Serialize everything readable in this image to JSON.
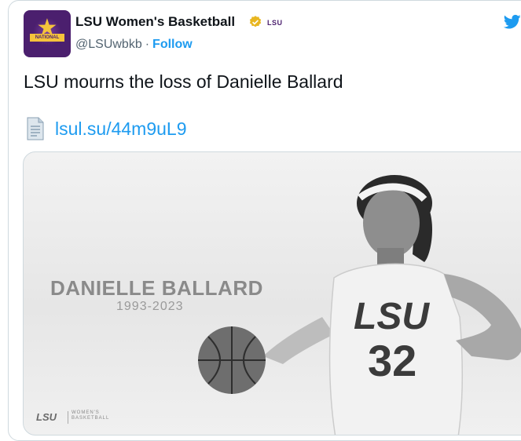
{
  "account": {
    "name": "LSU Women's Basketball",
    "handle": "@LSUwbkb",
    "separator": "·",
    "follow_label": "Follow",
    "lsu_mini": "LSU",
    "avatar_text": "NATIONAL CHAMPIONS"
  },
  "tweet": {
    "text": "LSU mourns the loss of Danielle Ballard",
    "link": "lsul.su/44m9uL9"
  },
  "media": {
    "player_name": "DANIELLE BALLARD",
    "years": "1993-2023",
    "jersey_text": "LSU",
    "jersey_number": "32",
    "footer_logo": "LSU",
    "footer_sub": "WOMEN'S BASKETBALL"
  },
  "colors": {
    "link": "#1d9bf0",
    "text": "#0f1419",
    "muted": "#536471",
    "verified": "#e8b620",
    "lsu_purple": "#4b1f6e"
  },
  "icons": [
    "verified-badge-icon",
    "twitter-bird-icon",
    "document-icon"
  ]
}
